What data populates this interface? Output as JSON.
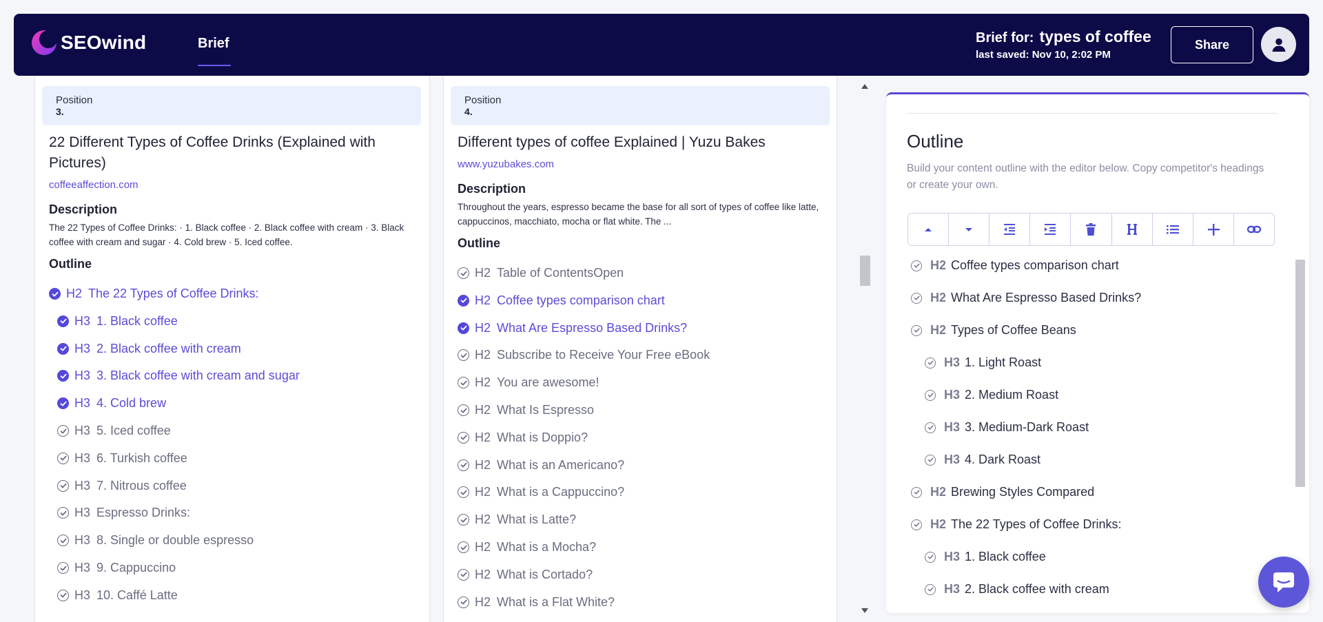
{
  "header": {
    "logo_text": "SEOwind",
    "nav_tab": "Brief",
    "brief_for_label": "Brief for:",
    "brief_keyword": "types of coffee",
    "last_saved": "last saved: Nov 10, 2:02 PM",
    "share_label": "Share"
  },
  "competitors": [
    {
      "position_label": "Position",
      "position": "3.",
      "title": "22 Different Types of Coffee Drinks (Explained with Pictures)",
      "url": "coffeeaffection.com",
      "description_label": "Description",
      "description": "The 22 Types of Coffee Drinks: · 1. Black coffee · 2. Black coffee with cream · 3. Black coffee with cream and sugar · 4. Cold brew · 5. Iced coffee.",
      "outline_label": "Outline",
      "outline": [
        {
          "tag": "H2",
          "text": "The 22 Types of Coffee Drinks:",
          "selected": true
        },
        {
          "tag": "H3",
          "text": "1. Black coffee",
          "selected": true
        },
        {
          "tag": "H3",
          "text": "2. Black coffee with cream",
          "selected": true
        },
        {
          "tag": "H3",
          "text": "3. Black coffee with cream and sugar",
          "selected": true
        },
        {
          "tag": "H3",
          "text": "4. Cold brew",
          "selected": true
        },
        {
          "tag": "H3",
          "text": "5. Iced coffee",
          "selected": false
        },
        {
          "tag": "H3",
          "text": "6. Turkish coffee",
          "selected": false
        },
        {
          "tag": "H3",
          "text": "7. Nitrous coffee",
          "selected": false
        },
        {
          "tag": "H3",
          "text": "Espresso Drinks:",
          "selected": false
        },
        {
          "tag": "H3",
          "text": "8. Single or double espresso",
          "selected": false
        },
        {
          "tag": "H3",
          "text": "9. Cappuccino",
          "selected": false
        },
        {
          "tag": "H3",
          "text": "10. Caffé Latte",
          "selected": false
        }
      ]
    },
    {
      "position_label": "Position",
      "position": "4.",
      "title": "Different types of coffee Explained | Yuzu Bakes",
      "url": "www.yuzubakes.com",
      "description_label": "Description",
      "description": "Throughout the years, espresso became the base for all sort of types of coffee like latte, cappuccinos, macchiato, mocha or flat white. The ...",
      "outline_label": "Outline",
      "outline": [
        {
          "tag": "H2",
          "text": "Table of ContentsOpen",
          "selected": false
        },
        {
          "tag": "H2",
          "text": "Coffee types comparison chart",
          "selected": true
        },
        {
          "tag": "H2",
          "text": "What Are Espresso Based Drinks?",
          "selected": true
        },
        {
          "tag": "H2",
          "text": "Subscribe to Receive Your Free eBook",
          "selected": false
        },
        {
          "tag": "H2",
          "text": "You are awesome!",
          "selected": false
        },
        {
          "tag": "H2",
          "text": "What Is Espresso",
          "selected": false
        },
        {
          "tag": "H2",
          "text": "What is Doppio?",
          "selected": false
        },
        {
          "tag": "H2",
          "text": "What is an Americano?",
          "selected": false
        },
        {
          "tag": "H2",
          "text": "What is a Cappuccino?",
          "selected": false
        },
        {
          "tag": "H2",
          "text": "What is Latte?",
          "selected": false
        },
        {
          "tag": "H2",
          "text": "What is a Mocha?",
          "selected": false
        },
        {
          "tag": "H2",
          "text": "What is Cortado?",
          "selected": false
        },
        {
          "tag": "H2",
          "text": "What is a Flat White?",
          "selected": false
        }
      ]
    }
  ],
  "editor": {
    "title": "Outline",
    "help_text": "Build your content outline with the editor below. Copy competitor's headings or create your own.",
    "toolbar": [
      "arrow-up-icon",
      "arrow-down-icon",
      "outdent-icon",
      "indent-icon",
      "trash-icon",
      "heading-icon",
      "list-icon",
      "plus-icon",
      "link-icon"
    ],
    "items": [
      {
        "tag": "H2",
        "text": "Coffee types comparison chart"
      },
      {
        "tag": "H2",
        "text": "What Are Espresso Based Drinks?"
      },
      {
        "tag": "H2",
        "text": "Types of Coffee Beans"
      },
      {
        "tag": "H3",
        "text": "1. Light Roast"
      },
      {
        "tag": "H3",
        "text": "2. Medium Roast"
      },
      {
        "tag": "H3",
        "text": "3. Medium-Dark Roast"
      },
      {
        "tag": "H3",
        "text": "4. Dark Roast"
      },
      {
        "tag": "H2",
        "text": "Brewing Styles Compared"
      },
      {
        "tag": "H2",
        "text": "The 22 Types of Coffee Drinks:"
      },
      {
        "tag": "H3",
        "text": "1. Black coffee"
      },
      {
        "tag": "H3",
        "text": "2. Black coffee with cream"
      }
    ]
  },
  "colors": {
    "header_bg": "#0d0a48",
    "accent": "#5548d9",
    "position_bg": "#eaf0fc"
  }
}
